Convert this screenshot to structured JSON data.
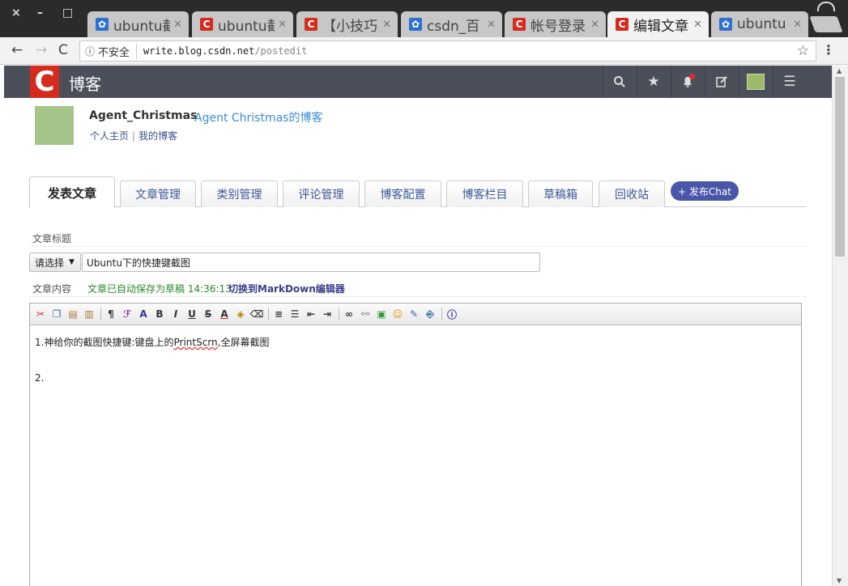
{
  "window": {
    "controls": [
      "×",
      "–",
      "□"
    ],
    "tabs": [
      {
        "icon": "paw-icon",
        "title": "ubuntu截",
        "active": false
      },
      {
        "icon": "csdn-icon",
        "title": "ubuntu截",
        "active": false
      },
      {
        "icon": "csdn-icon",
        "title": "【小技巧",
        "active": false
      },
      {
        "icon": "paw-icon",
        "title": "csdn_百",
        "active": false
      },
      {
        "icon": "csdn-icon",
        "title": "帐号登录",
        "active": false
      },
      {
        "icon": "csdn-icon",
        "title": "编辑文章",
        "active": true
      },
      {
        "icon": "paw-icon",
        "title": "ubuntu",
        "active": false
      }
    ]
  },
  "address": {
    "security": "不安全",
    "host": "write.blog.csdn.net",
    "path": "/postedit"
  },
  "header": {
    "logo": "C",
    "title": "博客"
  },
  "user": {
    "name": "Agent_Christmas",
    "blog": "Agent Christmas的博客",
    "home_link": "个人主页",
    "sep": "|",
    "myblog_link": "我的博客"
  },
  "tabs": [
    {
      "label": "发表文章",
      "active": true
    },
    {
      "label": "文章管理"
    },
    {
      "label": "类别管理"
    },
    {
      "label": "评论管理"
    },
    {
      "label": "博客配置"
    },
    {
      "label": "博客栏目"
    },
    {
      "label": "草稿箱"
    },
    {
      "label": "回收站"
    }
  ],
  "chat_button": "+ 发布Chat",
  "form": {
    "title_label": "文章标题",
    "category_select": "请选择",
    "title_value": "Ubuntu下的快捷键截图",
    "content_label": "文章内容",
    "autosave": "文章已自动保存为草稿 14:36:13",
    "switch_md": "切换到MarkDown编辑器"
  },
  "editor": {
    "line1_prefix": "1.神给你的截图快捷键:键盘上的",
    "line1_key": "PrintScrn",
    "line1_suffix": ",全屏幕截图",
    "line2": "2."
  }
}
